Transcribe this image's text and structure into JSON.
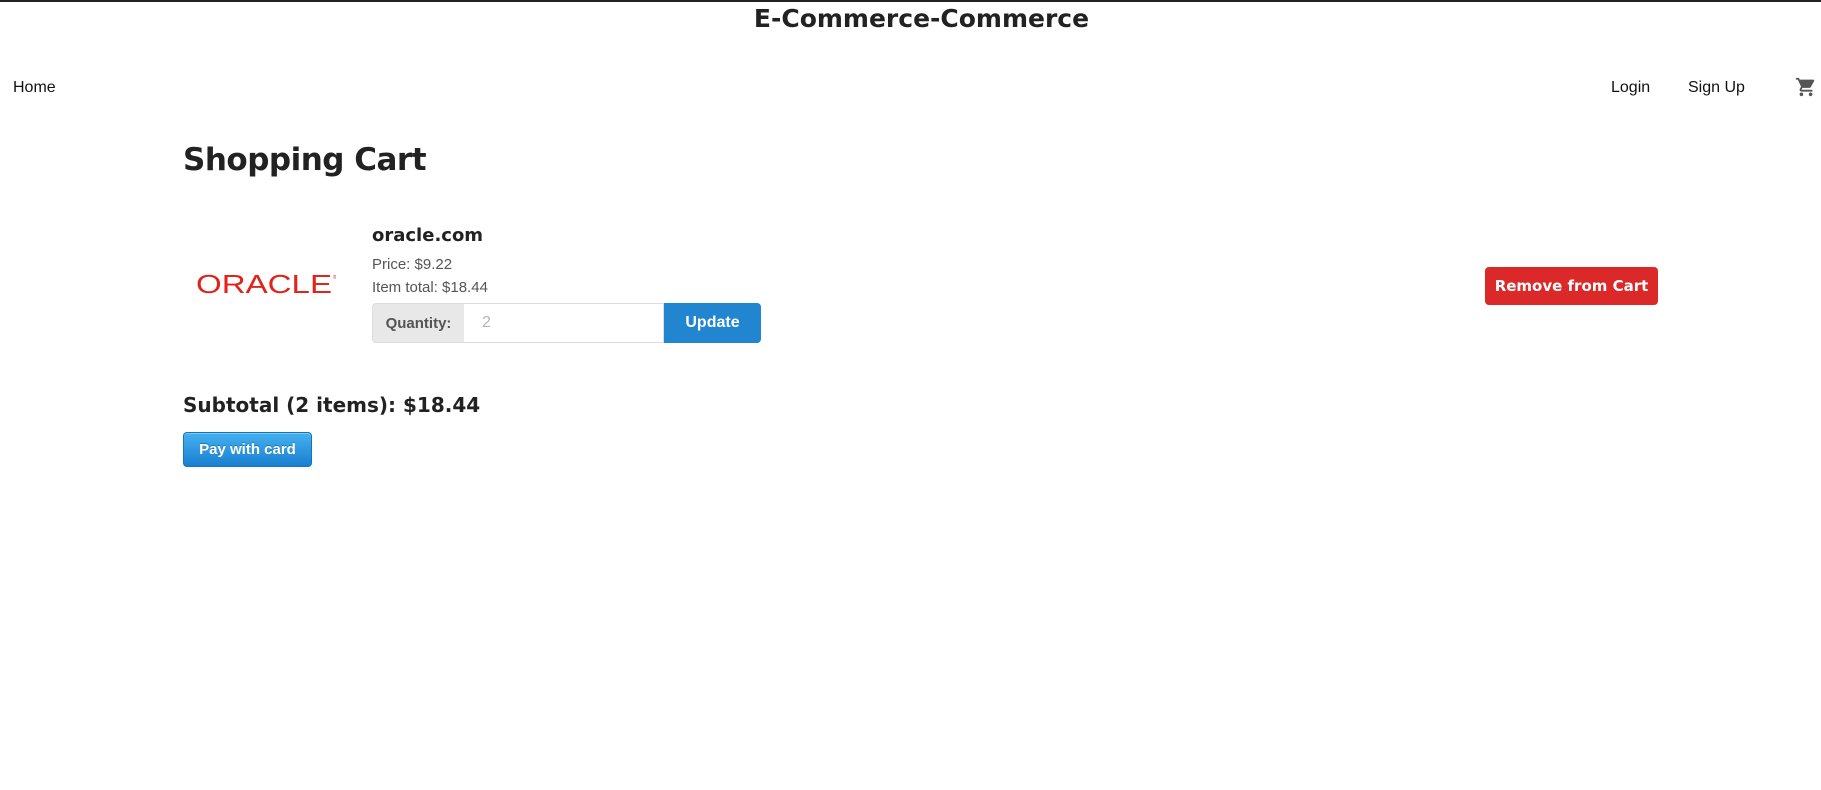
{
  "header": {
    "site_title": "E-Commerce-Commerce",
    "nav": {
      "home": "Home",
      "login": "Login",
      "signup": "Sign Up",
      "cart_icon": "shopping-cart-icon"
    }
  },
  "main": {
    "heading": "Shopping Cart",
    "cart_items": [
      {
        "logo_text": "ORACLE",
        "name": "oracle.com",
        "price": "Price: $9.22",
        "item_total": "Item total: $18.44",
        "quantity_label": "Quantity:",
        "quantity_placeholder": "2",
        "update_label": "Update",
        "remove_label": "Remove from Cart"
      }
    ],
    "subtotal": "Subtotal (2 items): $18.44",
    "pay_label": "Pay with card"
  },
  "colors": {
    "primary_blue": "#2185d0",
    "remove_red": "#db2828",
    "oracle_red": "#e2231a"
  }
}
